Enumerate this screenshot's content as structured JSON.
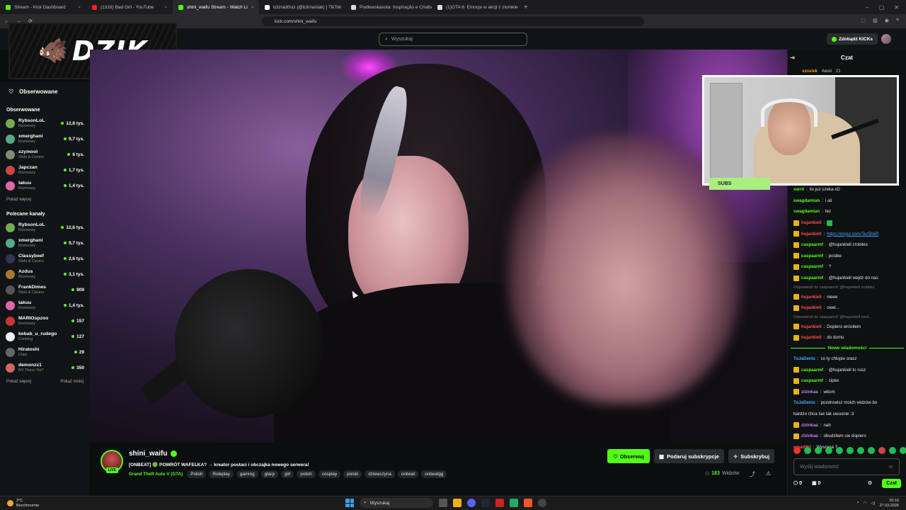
{
  "browser": {
    "tabs": [
      {
        "label": "Stream - Kick Dashboard",
        "color": "#53fc18",
        "active": false
      },
      {
        "label": "(1318) Bad Girl - YouTube",
        "color": "#ff2020",
        "active": false
      },
      {
        "label": "shini_waifu Stream - Watch Li",
        "color": "#53fc18",
        "active": true
      },
      {
        "label": "b3zrad0sci (@b3rnaniak) | TikTok",
        "color": "#fff",
        "active": false
      },
      {
        "label": "Podlewskaxola: Inspiração e Criativid",
        "color": "#ddd",
        "active": false
      },
      {
        "label": "(1)GTA 6: Emocje w akcji z ziomkiem",
        "color": "#ddd",
        "active": false
      }
    ],
    "url": "kick.com/shini_waifu"
  },
  "header": {
    "search_placeholder": "Wyszukaj",
    "kicks_label": "Zdobądź KICKs"
  },
  "overlay": {
    "logo_text": "DZIK",
    "subs_label": "SUBS"
  },
  "sidebar": {
    "follow_label": "Obserwowane",
    "followed_title": "Obserwowane",
    "followed": [
      {
        "name": "RybsonLoL",
        "category": "Rozmowy",
        "viewers": "12,8 tys.",
        "color": "#7a5"
      },
      {
        "name": "xmerghani",
        "category": "Rozmowy",
        "viewers": "9,7 tys.",
        "color": "#5a8"
      },
      {
        "name": "szymool",
        "category": "Slots & Casino",
        "viewers": "6 tys.",
        "color": "#887"
      },
      {
        "name": "Japczan",
        "category": "Rozmowy",
        "viewers": "1,7 tys.",
        "color": "#c44"
      },
      {
        "name": "takuu",
        "category": "Rozmowy",
        "viewers": "1,4 tys.",
        "color": "#d6a"
      }
    ],
    "followed_more": "Pokaż więcej",
    "recommended_title": "Polecane kanały",
    "recommended": [
      {
        "name": "RybsonLoL",
        "category": "Rozmowy",
        "viewers": "12,6 tys.",
        "color": "#7a5"
      },
      {
        "name": "xmerghani",
        "category": "Rozmowy",
        "viewers": "9,7 tys.",
        "color": "#5a8"
      },
      {
        "name": "Classybeef",
        "category": "Slots & Casino",
        "viewers": "2,6 tys.",
        "color": "#335"
      },
      {
        "name": "Azdus",
        "category": "Rozmowy",
        "viewers": "3,1 tys.",
        "color": "#a73"
      },
      {
        "name": "FrankDimes",
        "category": "Slots & Casino",
        "viewers": "909",
        "color": "#555"
      },
      {
        "name": "takuu",
        "category": "Rozmowy",
        "viewers": "1,4 tys.",
        "color": "#d6a"
      },
      {
        "name": "MARIOspzoo",
        "category": "Rozmowy",
        "viewers": "157",
        "color": "#c33"
      },
      {
        "name": "kebab_u_rudego",
        "category": "Cooking",
        "viewers": "127",
        "color": "#eee"
      },
      {
        "name": "Hiratoshi",
        "category": "Claw",
        "viewers": "29",
        "color": "#666"
      },
      {
        "name": "demonzz1",
        "category": "RV There Yet?",
        "viewers": "350",
        "color": "#c66"
      }
    ],
    "show_more": "Pokaż więcej",
    "show_less": "Pokaż mniej"
  },
  "stream": {
    "username": "shini_waifu",
    "live_badge": "LIVE",
    "title": "[ONBEAT] 🟢 POWRÓT WAFELKA? → kreator postaci i obczajka nowego serwera!",
    "game": "Grand Theft Auto V (GTA)",
    "tags": [
      "Polish",
      "Roleplay",
      "gaming",
      "gtarp",
      "girl",
      "polish",
      "cosplay",
      "polski",
      "dziewczyna",
      "onbeat",
      "onbeatgg"
    ],
    "follow_label": "Obserwuj",
    "gift_label": "Podaruj subskrypcje",
    "sub_label": "Subskrybuj",
    "viewers_count": "183",
    "viewers_label": "Widzów"
  },
  "chat": {
    "title": "Czat",
    "pinned_user": "szostek",
    "pinned_text": "Awsii",
    "pinned_count": "21",
    "new_messages": "Nowe wiadomości",
    "messages_before": [
      {
        "user": "xarril",
        "text": "llo juz czeka xD",
        "color": "#53fc18",
        "badge": false,
        "reply": false
      },
      {
        "user": "swagdamian",
        "text": "i ali",
        "color": "#53fc18",
        "badge": false,
        "reply": false
      },
      {
        "user": "swagdamian",
        "text": "tez",
        "color": "#53fc18",
        "badge": false,
        "reply": false
      },
      {
        "user": "hujankiell",
        "text": "",
        "color": "#ff4d4d",
        "badge": true,
        "reply": false
      },
      {
        "user": "hujankiell",
        "text": "https://imgur.com/Tez5hkR",
        "color": "#ff4d4d",
        "badge": true,
        "reply": false,
        "link": true
      },
      {
        "user": "caspaarmf",
        "text": "@hujankiell zrobiles",
        "color": "#53fc18",
        "badge": true,
        "reply": false
      },
      {
        "user": "caspaarmf",
        "text": "postke",
        "color": "#53fc18",
        "badge": true,
        "reply": false
      },
      {
        "user": "caspaarmf",
        "text": "?",
        "color": "#53fc18",
        "badge": true,
        "reply": false
      },
      {
        "user": "caspaarmf",
        "text": "@hujankiell wejdz do nas",
        "color": "#53fc18",
        "badge": true,
        "reply": false
      },
      {
        "user": "",
        "text": "Odpowiedź do caspaarmf: @hujankiell zrobiles",
        "color": "#777",
        "badge": false,
        "reply": true
      },
      {
        "user": "hujankiell",
        "text": "nieee",
        "color": "#ff4d4d",
        "badge": true,
        "reply": false
      },
      {
        "user": "hujankiell",
        "text": "cwel...",
        "color": "#ff4d4d",
        "badge": true,
        "reply": false
      },
      {
        "user": "",
        "text": "Odpowiedź do caspaarmf: @hujankiell cwel...",
        "color": "#777",
        "badge": false,
        "reply": true
      },
      {
        "user": "hujankiell",
        "text": "Doplero wróciłem",
        "color": "#ff4d4d",
        "badge": true,
        "reply": false
      },
      {
        "user": "hujankiell",
        "text": "do domu",
        "color": "#ff4d4d",
        "badge": true,
        "reply": false
      }
    ],
    "messages_after": [
      {
        "user": "ToJaDenis",
        "text": "co ty chlopie srasz",
        "color": "#3ab0ff",
        "badge": false
      },
      {
        "user": "caspaarmf",
        "text": "@hujankiell to rusz",
        "color": "#53fc18",
        "badge": true
      },
      {
        "user": "caspaarmf",
        "text": "cipke",
        "color": "#53fc18",
        "badge": true
      },
      {
        "user": "zlzinkaa",
        "text": "witom",
        "color": "#c77dff",
        "badge": true
      },
      {
        "user": "ToJaDenis",
        "text": "pozdrowisz moich widzów bo",
        "color": "#3ab0ff",
        "badge": false
      },
      {
        "user": "",
        "text": "bardzo chca Iae tak uwusnie :3",
        "color": "#e6e6e6",
        "badge": false
      },
      {
        "user": "zlzinkaa",
        "text": "nah",
        "color": "#c77dff",
        "badge": true
      },
      {
        "user": "zlzinkaa",
        "text": "obudziłam sie dopiero",
        "color": "#c77dff",
        "badge": true
      },
      {
        "user": "emadi93",
        "text": "Wysrana ?",
        "color": "#ff4d4d",
        "badge": false
      }
    ],
    "input_placeholder": "Wyślij wiadomość",
    "count_a": "0",
    "count_b": "0",
    "send_label": "Czat"
  },
  "taskbar": {
    "temp": "3°C",
    "weather": "Bezchmurnie",
    "search": "Wyszukaj",
    "time": "20:10",
    "date": "27.03.2026"
  }
}
